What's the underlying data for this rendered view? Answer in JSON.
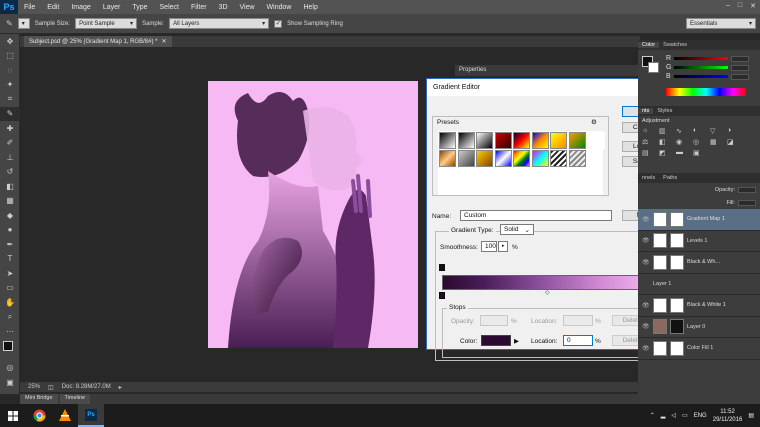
{
  "menubar": {
    "logo": "Ps",
    "items": [
      "File",
      "Edit",
      "Image",
      "Layer",
      "Type",
      "Select",
      "Filter",
      "3D",
      "View",
      "Window",
      "Help"
    ],
    "min": "–",
    "max": "□",
    "close": "✕"
  },
  "options": {
    "sample_size_label": "Sample Size:",
    "sample_size_value": "Point Sample",
    "sample_label": "Sample:",
    "sample_value": "All Layers",
    "sampling_ring_label": "Show Sampling Ring",
    "workspace": "Essentials"
  },
  "document": {
    "tab_title": "Subject.psd @ 25% (Gradient Map 1, RGB/8#) *",
    "tab_close": "✕"
  },
  "status": {
    "zoom": "25%",
    "doc": "Doc: 8.28M/27.0M"
  },
  "bottom_tabs": [
    "Mini Bridge",
    "Timeline"
  ],
  "properties_title": "Properties",
  "panels": {
    "color_tabs": [
      "Color",
      "Swatches"
    ],
    "color_rows": [
      "R",
      "G",
      "B"
    ],
    "adjust_tabs": [
      "nts",
      "Styles"
    ],
    "adjust_title": "Adjustment",
    "layers_tabs": [
      "nnels",
      "Paths"
    ],
    "opacity_label": "Opacity:",
    "fill_label": "Fill:",
    "layers": [
      {
        "name": "Gradient Map 1",
        "selected": true
      },
      {
        "name": "Levels 1",
        "selected": false
      },
      {
        "name": "Black & Wh...",
        "selected": false
      },
      {
        "name": "Layer 1",
        "selected": false
      },
      {
        "name": "Black & White 1",
        "selected": false
      },
      {
        "name": "Layer 0",
        "selected": false
      },
      {
        "name": "Color Fill 1",
        "selected": false
      }
    ]
  },
  "dialog": {
    "title": "Gradient Editor",
    "presets_label": "Presets",
    "ok": "OK",
    "cancel": "Cancel",
    "load": "Load...",
    "save": "Save...",
    "name_label": "Name:",
    "name_value": "Custom",
    "new": "New",
    "gradient_type_label": "Gradient Type:",
    "gradient_type_value": "Solid",
    "smoothness_label": "Smoothness:",
    "smoothness_value": "100",
    "percent": "%",
    "stops_label": "Stops",
    "opacity_label": "Opacity:",
    "location_label": "Location:",
    "delete": "Delete",
    "color_label": "Color:",
    "color_location_value": "0",
    "stop_color": "#2a0a2e",
    "end_color": "#f6b9f3"
  },
  "taskbar": {
    "lang": "ENG",
    "time": "11:52",
    "date": "29/11/2016"
  }
}
